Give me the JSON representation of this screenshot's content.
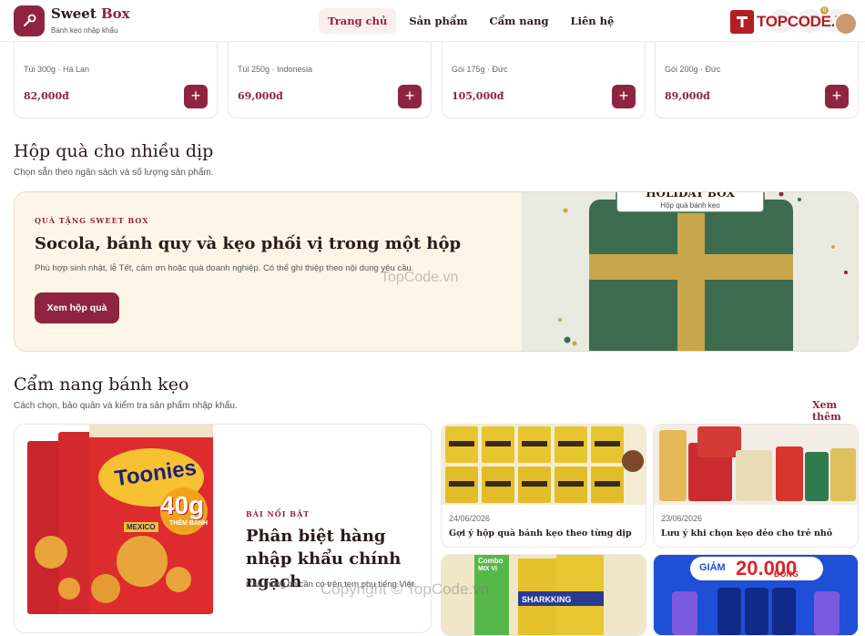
{
  "header": {
    "brand_main": "Sweet",
    "brand_accent": "Box",
    "tagline": "Bánh kẹo nhập khẩu",
    "nav": [
      "Trang chủ",
      "Sản phẩm",
      "Cẩm nang",
      "Liên hệ"
    ],
    "cart_count": "0",
    "partner_logo": "TOPCODE.VN"
  },
  "products": [
    {
      "meta": "Túi 300g · Hà Lan",
      "price": "82,000đ"
    },
    {
      "meta": "Túi 250g · Indonesia",
      "price": "69,000đ"
    },
    {
      "meta": "Gói 175g · Đức",
      "price": "105,000đ"
    },
    {
      "meta": "Gói 200g · Đức",
      "price": "89,000đ"
    }
  ],
  "gift_section": {
    "title": "Hộp quà cho nhiều dịp",
    "subtitle": "Chọn sẵn theo ngân sách và số lượng sản phẩm.",
    "kicker": "QUÀ TẶNG SWEET BOX",
    "banner_title": "Socola, bánh quy và kẹo phối vị trong một hộp",
    "banner_desc": "Phù hợp sinh nhật, lễ Tết, cảm ơn hoặc quà doanh nghiệp. Có thể ghi thiệp theo nội dung yêu cầu.",
    "button": "Xem hộp quà",
    "box_label": "HOLIDAY BOX",
    "box_sublabel": "Hộp quà bánh kẹo"
  },
  "guide_section": {
    "title": "Cẩm nang bánh kẹo",
    "subtitle": "Cách chọn, bảo quản và kiểm tra sản phẩm nhập khẩu.",
    "more": "Xem thêm",
    "featured": {
      "kicker": "BÀI NỔI BẬT",
      "title": "Phân biệt hàng nhập khẩu chính ngạch",
      "desc": "Các thông tin cần có trên tem phụ tiếng Việt.",
      "pack_brand": "Toonies",
      "pack_weight": "40g",
      "pack_extra": "THÊM BÁNH",
      "pack_flavor": "MEXICO"
    },
    "articles": [
      {
        "date": "24/06/2026",
        "title": "Gợi ý hộp quà bánh kẹo theo từng dịp"
      },
      {
        "date": "23/06/2026",
        "title": "Lưu ý khi chọn kẹo dẻo cho trẻ nhỏ"
      }
    ],
    "promo": {
      "text": "GIẢM",
      "amount": "20.000",
      "unit": "ĐỒNG"
    },
    "combo": {
      "line1": "Combo",
      "line2": "MIX VỊ",
      "brand": "SHARKKING"
    }
  },
  "watermarks": [
    "TopCode.vn",
    "Copyright © TopCode.vn"
  ],
  "colors": {
    "accent": "#8f2440",
    "gold": "#c8a64b",
    "box_green": "#3d6b4f"
  }
}
